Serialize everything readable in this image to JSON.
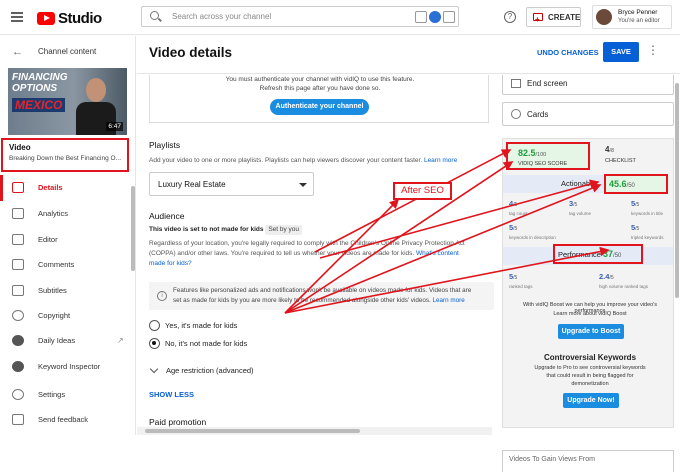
{
  "header": {
    "logo_text": "Studio",
    "search_placeholder": "Search across your channel",
    "help": "?",
    "create_label": "CREATE",
    "account_name": "Bryce Penner",
    "account_role": "You're an editor"
  },
  "sidebar": {
    "back_label": "Channel content",
    "thumb_title_1": "FINANCING",
    "thumb_title_2": "OPTIONS",
    "thumb_title_3": "MEXICO",
    "thumb_duration": "6:47",
    "video_label": "Video",
    "video_title": "Breaking Down the Best Financing O...",
    "items": [
      {
        "label": "Details",
        "icon": "pencil-icon",
        "active": true
      },
      {
        "label": "Analytics",
        "icon": "analytics-icon"
      },
      {
        "label": "Editor",
        "icon": "editor-icon"
      },
      {
        "label": "Comments",
        "icon": "comments-icon"
      },
      {
        "label": "Subtitles",
        "icon": "subtitles-icon"
      },
      {
        "label": "Copyright",
        "icon": "copyright-icon"
      },
      {
        "label": "Daily Ideas",
        "icon": "vidiq-icon"
      },
      {
        "label": "Keyword Inspector",
        "icon": "vidiq-icon"
      },
      {
        "label": "Settings",
        "icon": "gear-icon"
      },
      {
        "label": "Send feedback",
        "icon": "feedback-icon"
      }
    ]
  },
  "main": {
    "title": "Video details",
    "undo_label": "UNDO CHANGES",
    "save_label": "SAVE",
    "auth_line1": "You must authenticate your channel with vidIQ to use this feature.",
    "auth_line2": "Refresh this page after you have done so.",
    "auth_button": "Authenticate your channel",
    "playlists_title": "Playlists",
    "playlists_desc": "Add your video to one or more playlists. Playlists can help viewers discover your content faster.",
    "learn_more": "Learn more",
    "playlist_value": "Luxury Real Estate",
    "audience_title": "Audience",
    "audience_status": "This video is set to not made for kids",
    "set_by": "Set by you",
    "audience_desc_1": "Regardless of your location, you're legally required to comply with the Children's Online Privacy Protection Act",
    "audience_desc_2": "(COPPA) and/or other laws. You're required to tell us whether your videos are made for kids.",
    "audience_link_1": "What's content",
    "audience_link_2": "made for kids?",
    "info_text_1": "Features like personalized ads and notifications won't be available on videos made for kids. Videos that are",
    "info_text_2": "set as made for kids by you are more likely to be recommended alongside other kids' videos.",
    "info_link": "Learn more",
    "radio_kids": "Yes, it's made for kids",
    "radio_not_kids": "No, it's not made for kids",
    "age_restriction": "Age restriction (advanced)",
    "show_less": "SHOW LESS",
    "paid_promotion": "Paid promotion"
  },
  "right_panel": {
    "end_screen": "End screen",
    "cards": "Cards",
    "seo_score": "82.5",
    "seo_score_max": "/100",
    "seo_caption": "VIDIQ SEO SCORE",
    "checklist_score": "4",
    "checklist_max": "/8",
    "checklist_caption": "CHECKLIST",
    "actionable_label": "Actionable",
    "actionable_score": "45.6",
    "actionable_max": "/50",
    "metrics_a": [
      {
        "value": "4",
        "max": "/5",
        "caption": "tag count"
      },
      {
        "value": "3",
        "max": "/5",
        "caption": "tag volume"
      },
      {
        "value": "5",
        "max": "/5",
        "caption": "keywords in title"
      },
      {
        "value": "5",
        "max": "/5",
        "caption": "keywords in description"
      },
      {
        "value": "5",
        "max": "/5",
        "caption": "tripled keywords"
      }
    ],
    "performance_label": "Performance",
    "performance_score": "37",
    "performance_max": "/50",
    "metrics_b": [
      {
        "value": "5",
        "max": "/5",
        "caption": "ranked tags"
      },
      {
        "value": "2.4",
        "max": "/5",
        "caption": "high volume ranked tags"
      }
    ],
    "boost_desc": "With vidIQ Boost we can help you improve your video's performance",
    "boost_link": "Learn more about vidIQ Boost",
    "boost_button": "Upgrade to Boost",
    "controversial_title": "Controversial Keywords",
    "controversial_desc_1": "Upgrade to Pro to see controversial keywords",
    "controversial_desc_2": "that could result in being flagged for",
    "controversial_desc_3": "demonetization",
    "upgrade_now": "Upgrade Now!",
    "videos_to_gain": "Videos To Gain Views From"
  },
  "annotation": {
    "label": "After SEO",
    "color": "#e0141c"
  }
}
